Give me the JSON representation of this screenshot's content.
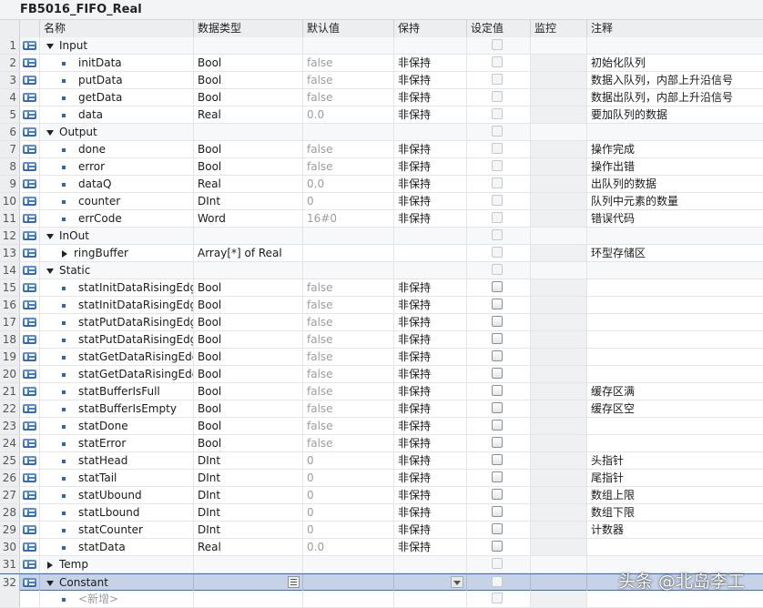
{
  "block_title": "FB5016_FIFO_Real",
  "columns": {
    "name": "名称",
    "type": "数据类型",
    "default": "默认值",
    "retain": "保持",
    "setpoint": "设定值",
    "monitor": "监控",
    "comment": "注释"
  },
  "rows": [
    {
      "num": "1",
      "kind": "section",
      "name": "Input",
      "expand": "down",
      "type": "",
      "default": "",
      "retain": "",
      "comment": ""
    },
    {
      "num": "2",
      "kind": "item",
      "name": "initData",
      "type": "Bool",
      "default": "false",
      "retain": "非保持",
      "comment": "初始化队列"
    },
    {
      "num": "3",
      "kind": "item",
      "name": "putData",
      "type": "Bool",
      "default": "false",
      "retain": "非保持",
      "comment": "数据入队列，内部上升沿信号"
    },
    {
      "num": "4",
      "kind": "item",
      "name": "getData",
      "type": "Bool",
      "default": "false",
      "retain": "非保持",
      "comment": "数据出队列，内部上升沿信号"
    },
    {
      "num": "5",
      "kind": "item",
      "name": "data",
      "type": "Real",
      "default": "0.0",
      "retain": "非保持",
      "comment": "要加队列的数据"
    },
    {
      "num": "6",
      "kind": "section",
      "name": "Output",
      "expand": "down",
      "type": "",
      "default": "",
      "retain": "",
      "comment": ""
    },
    {
      "num": "7",
      "kind": "item",
      "name": "done",
      "type": "Bool",
      "default": "false",
      "retain": "非保持",
      "comment": "操作完成"
    },
    {
      "num": "8",
      "kind": "item",
      "name": "error",
      "type": "Bool",
      "default": "false",
      "retain": "非保持",
      "comment": "操作出错"
    },
    {
      "num": "9",
      "kind": "item",
      "name": "dataQ",
      "type": "Real",
      "default": "0.0",
      "retain": "非保持",
      "comment": "出队列的数据"
    },
    {
      "num": "10",
      "kind": "item",
      "name": "counter",
      "type": "DInt",
      "default": "0",
      "retain": "非保持",
      "comment": "队列中元素的数量"
    },
    {
      "num": "11",
      "kind": "item",
      "name": "errCode",
      "type": "Word",
      "default": "16#0",
      "retain": "非保持",
      "comment": "错误代码"
    },
    {
      "num": "12",
      "kind": "section",
      "name": "InOut",
      "expand": "down",
      "type": "",
      "default": "",
      "retain": "",
      "comment": ""
    },
    {
      "num": "13",
      "kind": "subitem",
      "name": "ringBuffer",
      "expand": "right",
      "type": "Array[*] of Real",
      "default": "",
      "retain": "",
      "comment": "环型存储区"
    },
    {
      "num": "14",
      "kind": "section",
      "name": "Static",
      "expand": "down",
      "type": "",
      "default": "",
      "retain": "",
      "comment": ""
    },
    {
      "num": "15",
      "kind": "static",
      "name": "statInitDataRisingEdge",
      "type": "Bool",
      "default": "false",
      "retain": "非保持",
      "comment": ""
    },
    {
      "num": "16",
      "kind": "static",
      "name": "statInitDataRisingEdge...",
      "type": "Bool",
      "default": "false",
      "retain": "非保持",
      "comment": ""
    },
    {
      "num": "17",
      "kind": "static",
      "name": "statPutDataRisingEdge",
      "type": "Bool",
      "default": "false",
      "retain": "非保持",
      "comment": ""
    },
    {
      "num": "18",
      "kind": "static",
      "name": "statPutDataRisingEdge...",
      "type": "Bool",
      "default": "false",
      "retain": "非保持",
      "comment": ""
    },
    {
      "num": "19",
      "kind": "static",
      "name": "statGetDataRisingEdge",
      "type": "Bool",
      "default": "false",
      "retain": "非保持",
      "comment": ""
    },
    {
      "num": "20",
      "kind": "static",
      "name": "statGetDataRisingEdg...",
      "type": "Bool",
      "default": "false",
      "retain": "非保持",
      "comment": ""
    },
    {
      "num": "21",
      "kind": "static",
      "name": "statBufferIsFull",
      "type": "Bool",
      "default": "false",
      "retain": "非保持",
      "comment": "缓存区满"
    },
    {
      "num": "22",
      "kind": "static",
      "name": "statBufferIsEmpty",
      "type": "Bool",
      "default": "false",
      "retain": "非保持",
      "comment": "缓存区空"
    },
    {
      "num": "23",
      "kind": "static",
      "name": "statDone",
      "type": "Bool",
      "default": "false",
      "retain": "非保持",
      "comment": ""
    },
    {
      "num": "24",
      "kind": "static",
      "name": "statError",
      "type": "Bool",
      "default": "false",
      "retain": "非保持",
      "comment": ""
    },
    {
      "num": "25",
      "kind": "static",
      "name": "statHead",
      "type": "DInt",
      "default": "0",
      "retain": "非保持",
      "comment": "头指针"
    },
    {
      "num": "26",
      "kind": "static",
      "name": "statTail",
      "type": "DInt",
      "default": "0",
      "retain": "非保持",
      "comment": "尾指针"
    },
    {
      "num": "27",
      "kind": "static",
      "name": "statUbound",
      "type": "DInt",
      "default": "0",
      "retain": "非保持",
      "comment": "数组上限"
    },
    {
      "num": "28",
      "kind": "static",
      "name": "statLbound",
      "type": "DInt",
      "default": "0",
      "retain": "非保持",
      "comment": "数组下限"
    },
    {
      "num": "29",
      "kind": "static",
      "name": "statCounter",
      "type": "DInt",
      "default": "0",
      "retain": "非保持",
      "comment": "计数器"
    },
    {
      "num": "30",
      "kind": "static",
      "name": "statData",
      "type": "Real",
      "default": "0.0",
      "retain": "非保持",
      "comment": ""
    },
    {
      "num": "31",
      "kind": "section",
      "name": "Temp",
      "expand": "right",
      "type": "",
      "default": "",
      "retain": "",
      "comment": ""
    },
    {
      "num": "32",
      "kind": "selected",
      "name": "Constant",
      "expand": "down",
      "type": "",
      "default": "",
      "retain": "",
      "comment": ""
    },
    {
      "num": "",
      "kind": "new",
      "name": "<新增>",
      "type": "",
      "default": "",
      "retain": "",
      "comment": ""
    }
  ],
  "watermark": "头条 @北岛李工",
  "colors": {
    "accent": "#2c66b0",
    "selection": "#c6d3e6",
    "header": "#eceef0"
  }
}
